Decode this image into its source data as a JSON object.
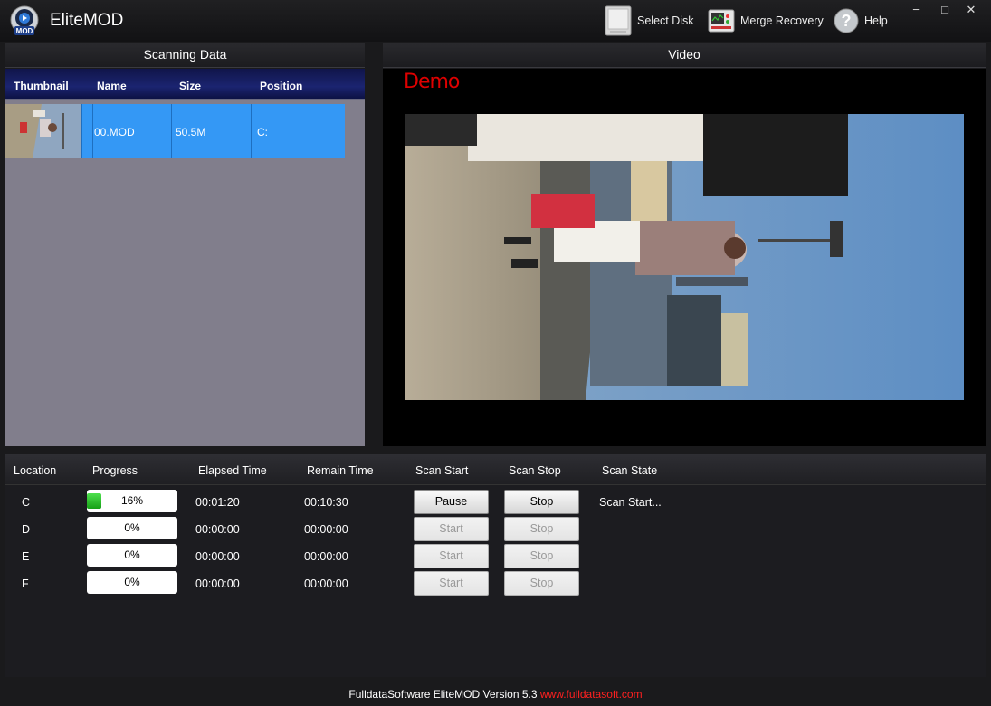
{
  "app": {
    "title": "EliteMOD",
    "logo_text": "MOD"
  },
  "toolbar": {
    "select_disk": "Select Disk",
    "merge_recovery": "Merge Recovery",
    "help": "Help"
  },
  "window_controls": {
    "minimize": "−",
    "maximize": "□",
    "close": "✕"
  },
  "scanning_panel": {
    "title": "Scanning  Data",
    "columns": [
      "Thumbnail",
      "Name",
      "Size",
      "Position"
    ],
    "files": [
      {
        "name": "00.MOD",
        "size": "50.5M",
        "position": "C:"
      }
    ]
  },
  "video_panel": {
    "title": "Video",
    "watermark": "Demo"
  },
  "scan_table": {
    "columns": [
      "Location",
      "Progress",
      "Elapsed Time",
      "Remain  Time",
      "Scan Start",
      "Scan Stop",
      "Scan State"
    ],
    "rows": [
      {
        "location": "C",
        "progress": 0.16,
        "progress_label": "16%",
        "elapsed": "00:01:20",
        "remain": "00:10:30",
        "start_label": "Pause",
        "stop_label": "Stop",
        "state": "Scan Start...",
        "enabled": true
      },
      {
        "location": "D",
        "progress": 0,
        "progress_label": "0%",
        "elapsed": "00:00:00",
        "remain": "00:00:00",
        "start_label": "Start",
        "stop_label": "Stop",
        "state": "",
        "enabled": false
      },
      {
        "location": "E",
        "progress": 0,
        "progress_label": "0%",
        "elapsed": "00:00:00",
        "remain": "00:00:00",
        "start_label": "Start",
        "stop_label": "Stop",
        "state": "",
        "enabled": false
      },
      {
        "location": "F",
        "progress": 0,
        "progress_label": "0%",
        "elapsed": "00:00:00",
        "remain": "00:00:00",
        "start_label": "Start",
        "stop_label": "Stop",
        "state": "",
        "enabled": false
      }
    ]
  },
  "footer": {
    "text": "FulldataSoftware EliteMOD Version 5.3 ",
    "link": "www.fulldatasoft.com"
  },
  "colors": {
    "selection": "#3498f5",
    "progress_green": "#2ec42e",
    "watermark_red": "#dd0000",
    "link_red": "#ff2020"
  },
  "icons": [
    "mod-logo-icon",
    "disk-icon",
    "merge-recovery-icon",
    "help-icon"
  ]
}
